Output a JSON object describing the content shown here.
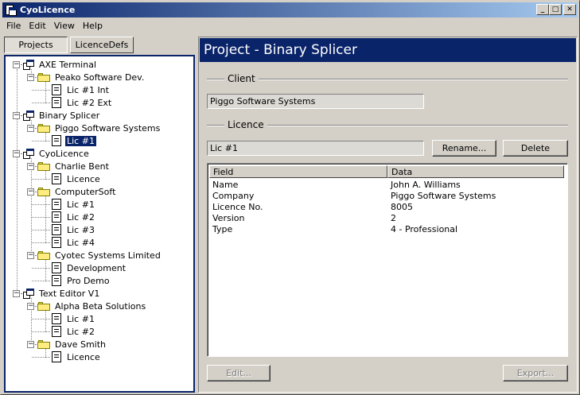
{
  "window": {
    "title": "CyoLicence",
    "minimize": "_",
    "maximize": "□",
    "close": "✕"
  },
  "menu": [
    "File",
    "Edit",
    "View",
    "Help"
  ],
  "tabs": [
    "Projects",
    "LicenceDefs"
  ],
  "tree": [
    {
      "label": "AXE Terminal",
      "type": "project",
      "level": 0,
      "toggle": "−"
    },
    {
      "label": "Peako Software Dev.",
      "type": "folder",
      "level": 1,
      "toggle": "−"
    },
    {
      "label": "Lic #1 Int",
      "type": "doc",
      "level": 2
    },
    {
      "label": "Lic #2 Ext",
      "type": "doc",
      "level": 2
    },
    {
      "label": "Binary Splicer",
      "type": "project",
      "level": 0,
      "toggle": "−"
    },
    {
      "label": "Piggo Software Systems",
      "type": "folder",
      "level": 1,
      "toggle": "−"
    },
    {
      "label": "Lic #1",
      "type": "doc",
      "level": 2,
      "selected": true
    },
    {
      "label": "CyoLicence",
      "type": "project",
      "level": 0,
      "toggle": "−"
    },
    {
      "label": "Charlie Bent",
      "type": "folder",
      "level": 1,
      "toggle": "−"
    },
    {
      "label": "Licence",
      "type": "doc",
      "level": 2
    },
    {
      "label": "ComputerSoft",
      "type": "folder",
      "level": 1,
      "toggle": "−"
    },
    {
      "label": "Lic #1",
      "type": "doc",
      "level": 2
    },
    {
      "label": "Lic #2",
      "type": "doc",
      "level": 2
    },
    {
      "label": "Lic #3",
      "type": "doc",
      "level": 2
    },
    {
      "label": "Lic #4",
      "type": "doc",
      "level": 2
    },
    {
      "label": "Cyotec Systems Limited",
      "type": "folder",
      "level": 1,
      "toggle": "−"
    },
    {
      "label": "Development",
      "type": "doc",
      "level": 2
    },
    {
      "label": "Pro Demo",
      "type": "doc",
      "level": 2
    },
    {
      "label": "Text Editor V1",
      "type": "project",
      "level": 0,
      "toggle": "−"
    },
    {
      "label": "Alpha Beta Solutions",
      "type": "folder",
      "level": 1,
      "toggle": "−"
    },
    {
      "label": "Lic #1",
      "type": "doc",
      "level": 2
    },
    {
      "label": "Lic #2",
      "type": "doc",
      "level": 2
    },
    {
      "label": "Dave Smith",
      "type": "folder",
      "level": 1,
      "toggle": "−"
    },
    {
      "label": "Licence",
      "type": "doc",
      "level": 2
    }
  ],
  "panel": {
    "header": "Project - Binary Splicer",
    "client_label": "Client",
    "client_value": "Piggo Software Systems",
    "licence_label": "Licence",
    "licence_value": "Lic #1",
    "rename_button": "Rename...",
    "delete_button": "Delete",
    "edit_button": "Edit...",
    "export_button": "Export...",
    "columns": [
      "Field",
      "Data"
    ],
    "rows": [
      {
        "field": "Name",
        "data": "John A. Williams"
      },
      {
        "field": "Company",
        "data": "Piggo Software Systems"
      },
      {
        "field": "Licence No.",
        "data": "8005"
      },
      {
        "field": "Version",
        "data": "2"
      },
      {
        "field": "Type",
        "data": "4 - Professional"
      }
    ]
  },
  "colors": {
    "accent": "#0a246a",
    "face": "#d4d0c8"
  }
}
